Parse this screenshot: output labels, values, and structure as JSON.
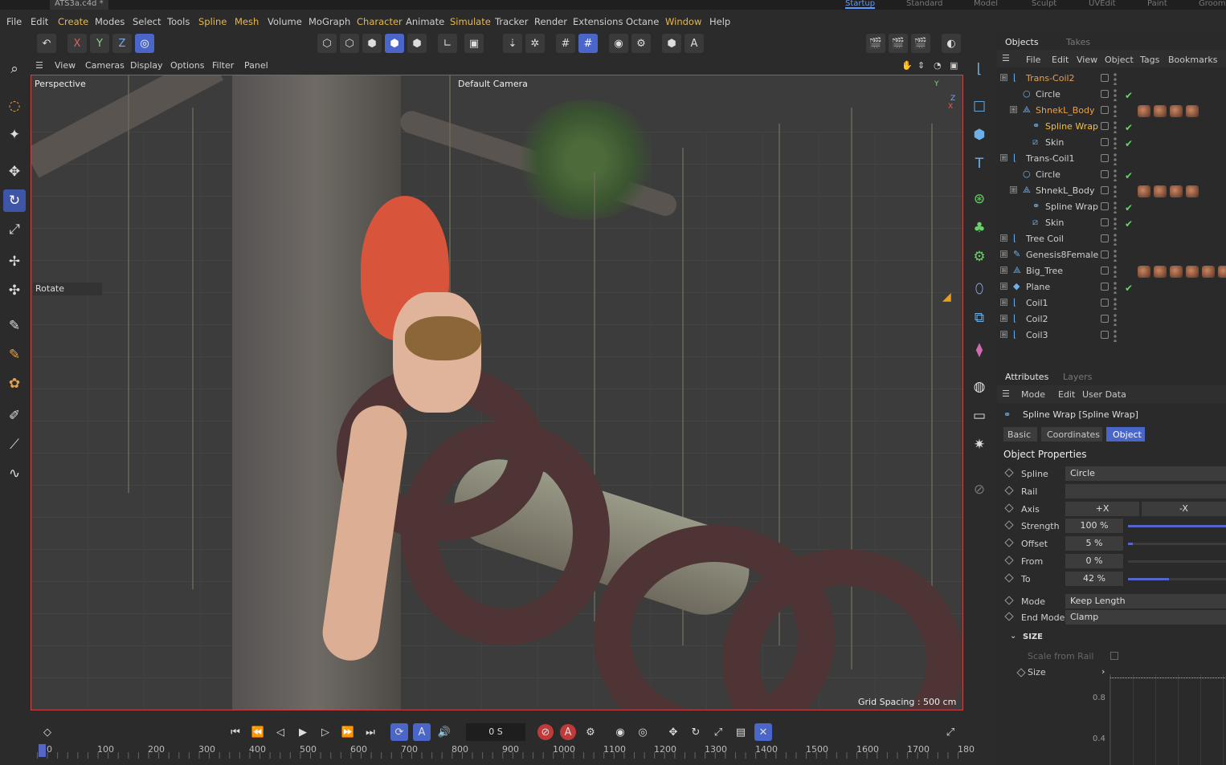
{
  "title_bar": {
    "doc_tab": "ATS3a.c4d *",
    "layouts": [
      "Startup",
      "Standard",
      "Model",
      "Sculpt",
      "UVEdit",
      "Paint",
      "Groom"
    ],
    "active_layout": "Startup"
  },
  "menu": [
    "File",
    "Edit",
    "Create",
    "Modes",
    "Select",
    "Tools",
    "Spline",
    "Mesh",
    "Volume",
    "MoGraph",
    "Character",
    "Animate",
    "Simulate",
    "Tracker",
    "Render",
    "Extensions",
    "Octane",
    "Window",
    "Help"
  ],
  "toolbar": {
    "axes": [
      "X",
      "Y",
      "Z"
    ]
  },
  "viewport": {
    "menu": [
      "View",
      "Cameras",
      "Display",
      "Options",
      "Filter",
      "Panel"
    ],
    "name": "Perspective",
    "camera": "Default Camera",
    "grid_spacing": "Grid Spacing : 500 cm",
    "tool_label": "Rotate",
    "axis": {
      "y": "Y",
      "z": "Z",
      "x": "X"
    }
  },
  "objects_panel": {
    "tabs": [
      "Objects",
      "Takes"
    ],
    "menu": [
      "File",
      "Edit",
      "View",
      "Object",
      "Tags",
      "Bookmarks"
    ],
    "rows": [
      {
        "name": "Trans-Coil2",
        "level": 0,
        "icon": "null-icon",
        "color": "#e8a04a",
        "check": false
      },
      {
        "name": "Circle",
        "level": 1,
        "icon": "circle-icon",
        "color": "#cfcfcf",
        "check": true
      },
      {
        "name": "ShnekL_Body",
        "level": 1,
        "icon": "polygon-icon",
        "color": "#e8a04a",
        "check": false
      },
      {
        "name": "Spline Wrap",
        "level": 2,
        "icon": "spline-wrap-icon",
        "color": "#f0c040",
        "check": true
      },
      {
        "name": "Skin",
        "level": 2,
        "icon": "skin-icon",
        "color": "#cfcfcf",
        "check": true
      },
      {
        "name": "Trans-Coil1",
        "level": 0,
        "icon": "null-icon",
        "color": "#cfcfcf",
        "check": false
      },
      {
        "name": "Circle",
        "level": 1,
        "icon": "circle-icon",
        "color": "#cfcfcf",
        "check": true
      },
      {
        "name": "ShnekL_Body",
        "level": 1,
        "icon": "polygon-icon",
        "color": "#cfcfcf",
        "check": false
      },
      {
        "name": "Spline Wrap",
        "level": 2,
        "icon": "spline-wrap-icon",
        "color": "#cfcfcf",
        "check": true
      },
      {
        "name": "Skin",
        "level": 2,
        "icon": "skin-icon",
        "color": "#cfcfcf",
        "check": true
      },
      {
        "name": "Tree Coil",
        "level": 0,
        "icon": "null-icon",
        "color": "#cfcfcf",
        "check": false
      },
      {
        "name": "Genesis8Female",
        "level": 0,
        "icon": "figure-icon",
        "color": "#cfcfcf",
        "check": false
      },
      {
        "name": "Big_Tree",
        "level": 0,
        "icon": "polygon-icon",
        "color": "#cfcfcf",
        "check": false
      },
      {
        "name": "Plane",
        "level": 0,
        "icon": "plane-icon",
        "color": "#cfcfcf",
        "check": true
      },
      {
        "name": "Coil1",
        "level": 0,
        "icon": "null-icon",
        "color": "#cfcfcf",
        "check": false
      },
      {
        "name": "Coil2",
        "level": 0,
        "icon": "null-icon",
        "color": "#cfcfcf",
        "check": false
      },
      {
        "name": "Coil3",
        "level": 0,
        "icon": "null-icon",
        "color": "#cfcfcf",
        "check": false
      }
    ]
  },
  "attributes": {
    "tabs": [
      "Attributes",
      "Layers"
    ],
    "menu": [
      "Mode",
      "Edit",
      "User Data"
    ],
    "object_title": "Spline Wrap [Spline Wrap]",
    "sub_tabs": [
      "Basic",
      "Coordinates",
      "Object"
    ],
    "active_sub_tab": "Object",
    "section": "Object Properties",
    "spline": {
      "label": "Spline",
      "value": "Circle"
    },
    "rail": {
      "label": "Rail",
      "value": ""
    },
    "axis": {
      "label": "Axis",
      "opt1": "+X",
      "opt2": "-X"
    },
    "strength": {
      "label": "Strength",
      "value": "100 %",
      "fraction": 1.0
    },
    "offset": {
      "label": "Offset",
      "value": "5 %",
      "fraction": 0.05
    },
    "from": {
      "label": "From",
      "value": "0 %",
      "fraction": 0.0
    },
    "to": {
      "label": "To",
      "value": "42 %",
      "fraction": 0.42
    },
    "mode": {
      "label": "Mode",
      "value": "Keep Length"
    },
    "end_mode": {
      "label": "End Mode",
      "value": "Clamp"
    },
    "size_section": "SIZE",
    "scale_from_rail": "Scale from Rail",
    "size": "Size",
    "graph_ticks": [
      "0.8",
      "0.4"
    ]
  },
  "timeline": {
    "current_time": "0 S",
    "ruler": [
      "0",
      "100",
      "200",
      "300",
      "400",
      "500",
      "600",
      "700",
      "800",
      "900",
      "1000",
      "1100",
      "1200",
      "1300",
      "1400",
      "1500",
      "1600",
      "1700",
      "180"
    ]
  }
}
